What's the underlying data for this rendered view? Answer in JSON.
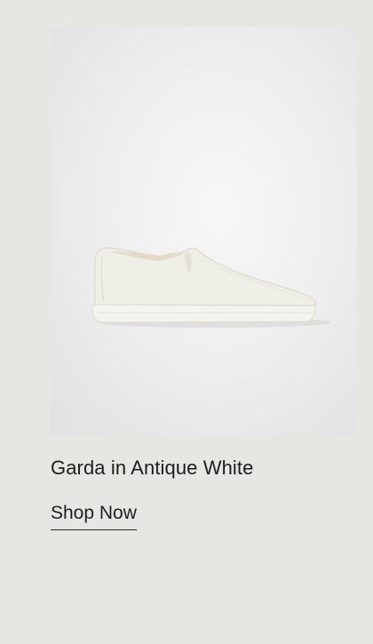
{
  "product": {
    "title": "Garda in Antique White",
    "image_alt": "Garda slip-on shoe in Antique White",
    "cta_label": "Shop Now"
  },
  "colors": {
    "page_background": "#e8e6e2",
    "text": "#1e1e1e"
  }
}
